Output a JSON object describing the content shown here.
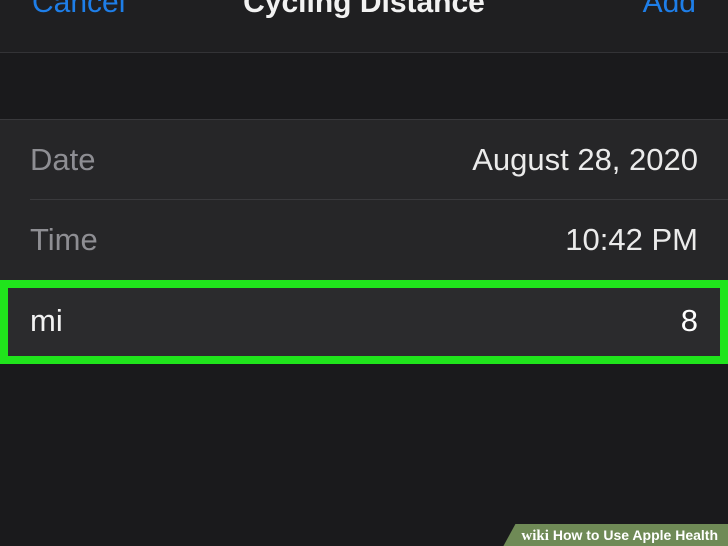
{
  "nav": {
    "cancel_label": "Cancel",
    "title": "Cycling Distance",
    "add_label": "Add"
  },
  "form": {
    "rows": [
      {
        "label": "Date",
        "value": "August 28, 2020"
      },
      {
        "label": "Time",
        "value": "10:42 PM"
      },
      {
        "label": "mi",
        "value": "8"
      }
    ]
  },
  "watermark": {
    "brand": "wiki",
    "text": "How to Use Apple Health"
  },
  "colors": {
    "accent": "#1e7ee8",
    "highlight": "#20e41c",
    "background": "#1a1a1c",
    "row_background": "#262628"
  }
}
